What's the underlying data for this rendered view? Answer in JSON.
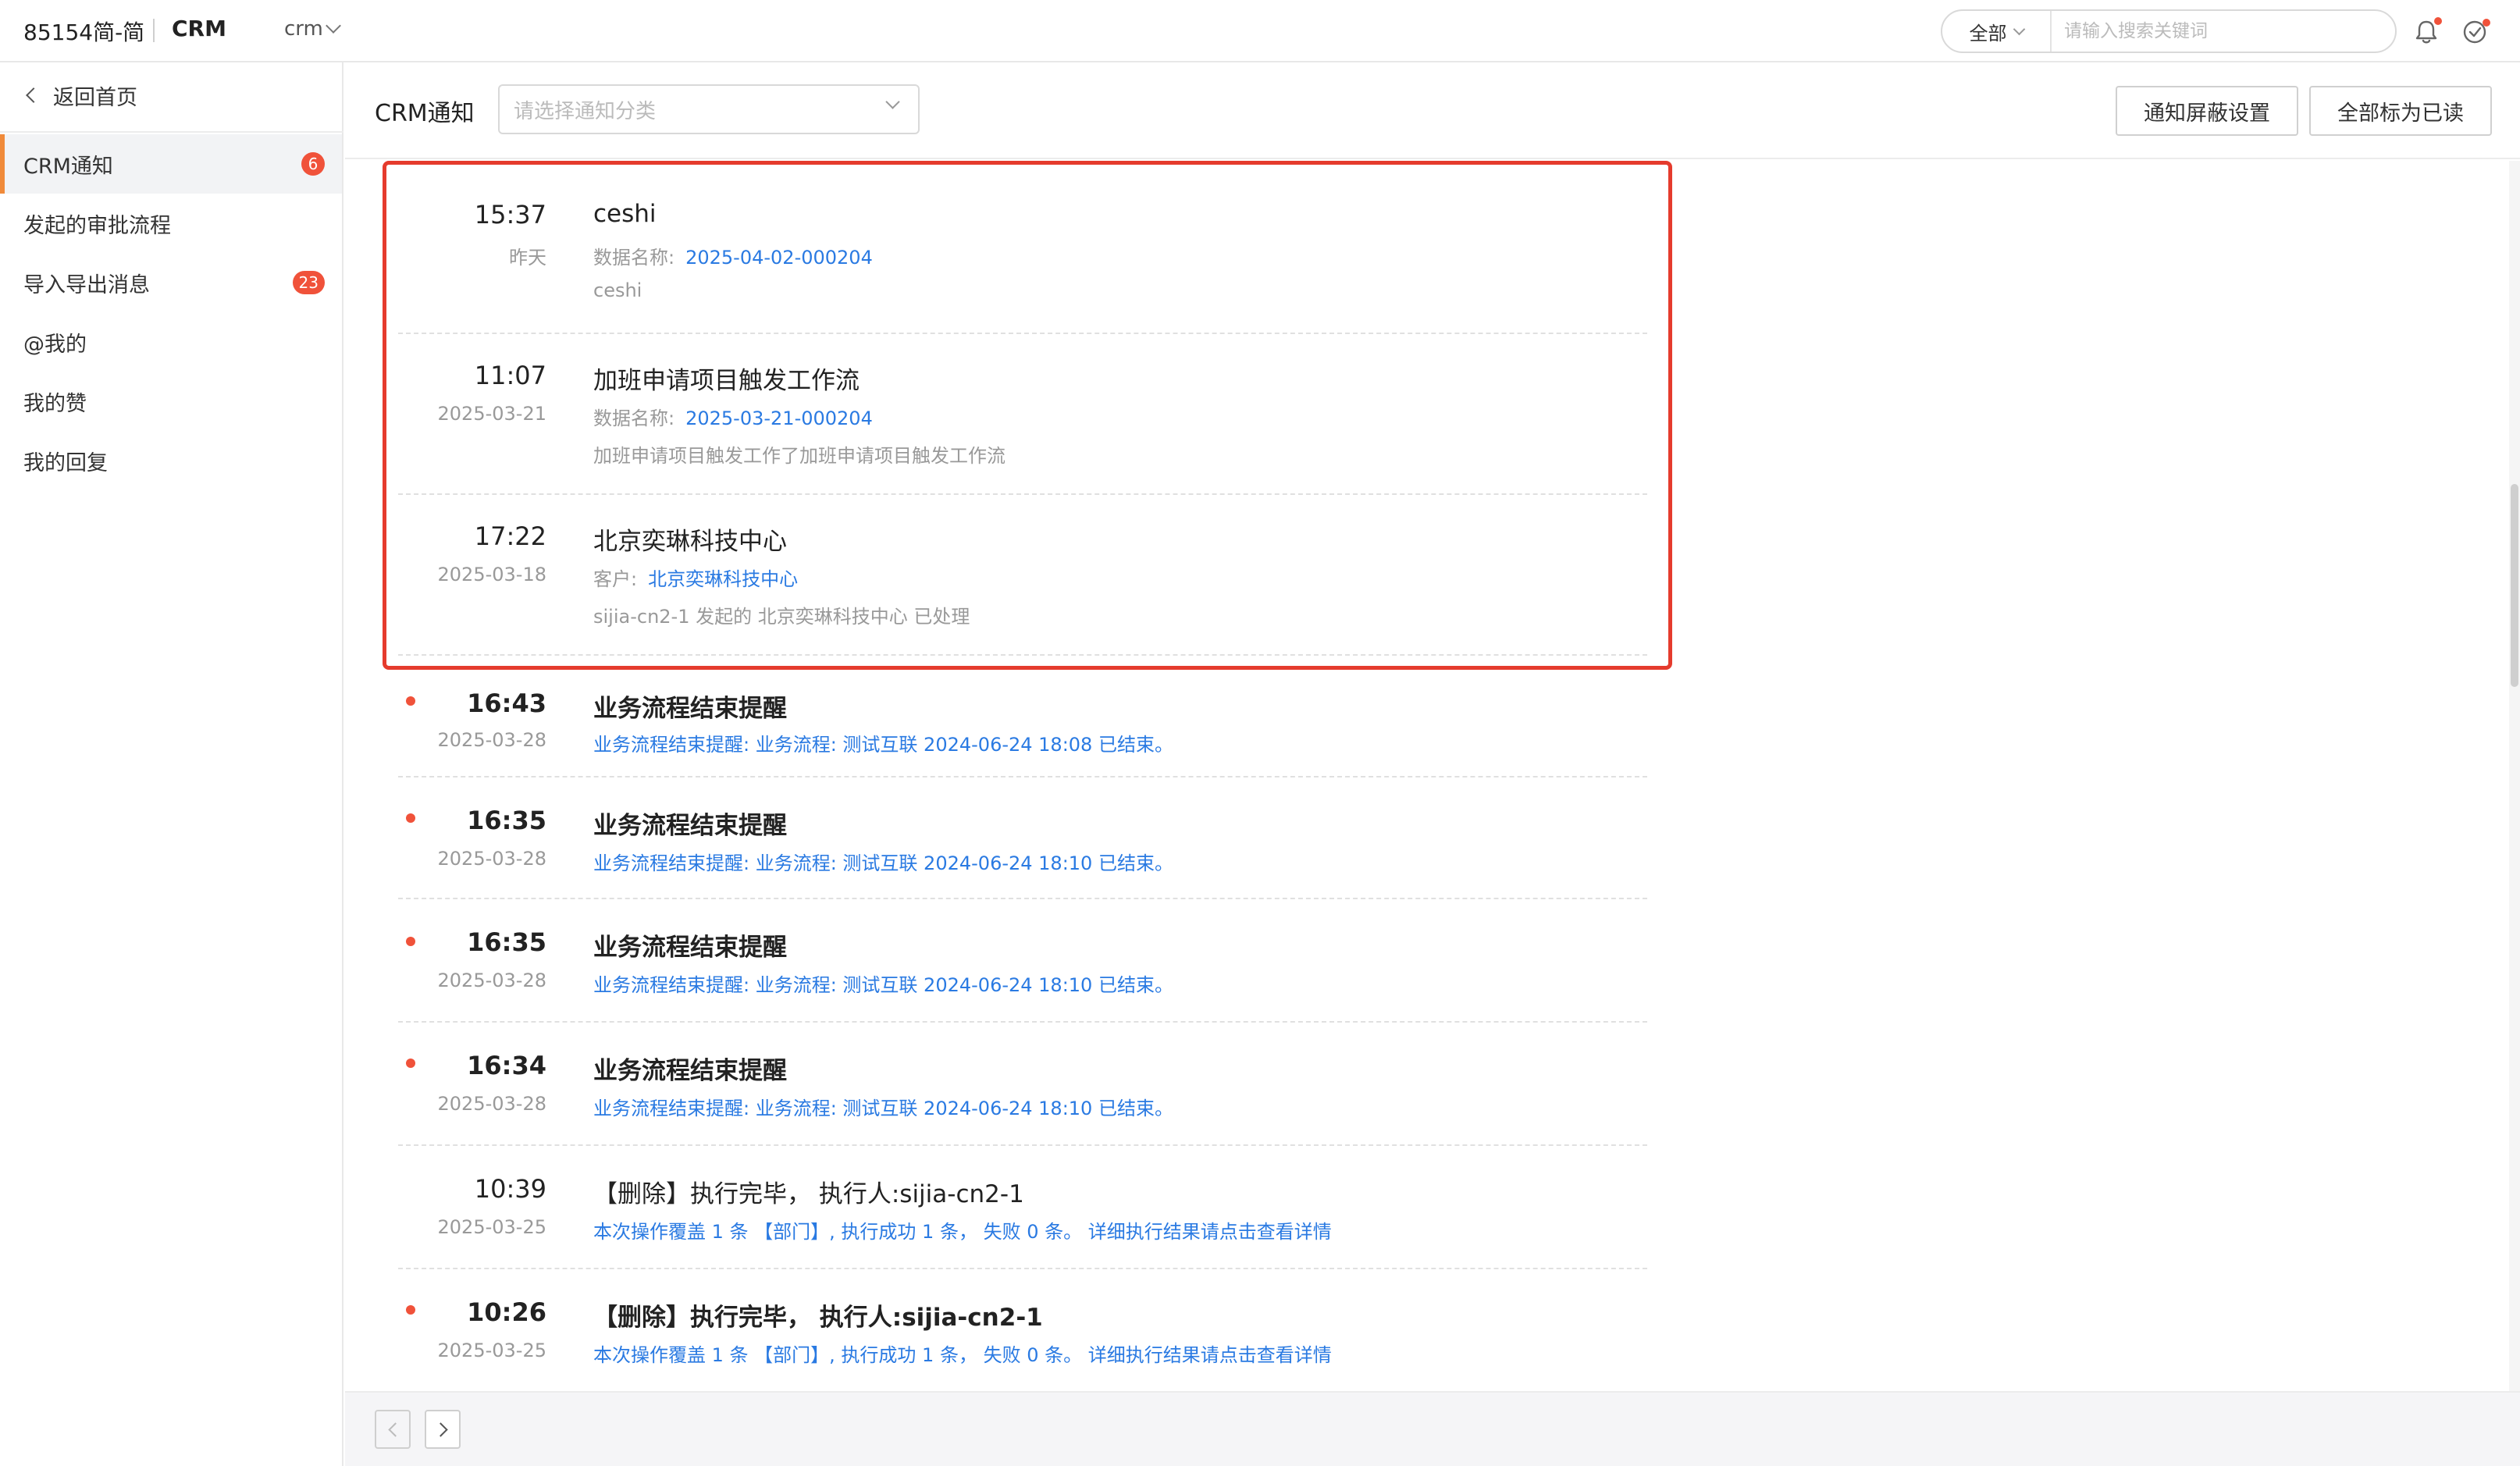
{
  "topbar": {
    "brand": "85154简-简",
    "app_name": "CRM",
    "switcher_label": "crm",
    "search_scope": "全部",
    "search_placeholder": "请输入搜索关键词"
  },
  "sidebar": {
    "back_label": "返回首页",
    "items": [
      {
        "label": "CRM通知",
        "badge": "6",
        "active": true
      },
      {
        "label": "发起的审批流程",
        "badge": ""
      },
      {
        "label": "导入导出消息",
        "badge": "23"
      },
      {
        "label": "@我的",
        "badge": ""
      },
      {
        "label": "我的赞",
        "badge": ""
      },
      {
        "label": "我的回复",
        "badge": ""
      }
    ]
  },
  "main": {
    "title": "CRM通知",
    "category_placeholder": "请选择通知分类",
    "mute_settings_label": "通知屏蔽设置",
    "mark_all_read_label": "全部标为已读"
  },
  "notifications": [
    {
      "time": "15:37",
      "date": "昨天",
      "title": "ceshi",
      "field_label": "数据名称:",
      "field_value": "2025-04-02-000204",
      "desc": "ceshi",
      "unread": false
    },
    {
      "time": "11:07",
      "date": "2025-03-21",
      "title": "加班申请项目触发工作流",
      "field_label": "数据名称:",
      "field_value": "2025-03-21-000204",
      "desc": "加班申请项目触发工作了加班申请项目触发工作流",
      "unread": false
    },
    {
      "time": "17:22",
      "date": "2025-03-18",
      "title": "北京奕琳科技中心",
      "field_label": "客户:",
      "field_value": "北京奕琳科技中心",
      "desc": "sijia-cn2-1 发起的 北京奕琳科技中心 已处理",
      "unread": false
    },
    {
      "time": "16:43",
      "date": "2025-03-28",
      "title": "业务流程结束提醒",
      "link": "业务流程结束提醒:  业务流程: 测试互联 2024-06-24 18:08 已结束。",
      "unread": true
    },
    {
      "time": "16:35",
      "date": "2025-03-28",
      "title": "业务流程结束提醒",
      "link": "业务流程结束提醒:  业务流程: 测试互联 2024-06-24 18:10 已结束。",
      "unread": true
    },
    {
      "time": "16:35",
      "date": "2025-03-28",
      "title": "业务流程结束提醒",
      "link": "业务流程结束提醒:  业务流程: 测试互联 2024-06-24 18:10 已结束。",
      "unread": true
    },
    {
      "time": "16:34",
      "date": "2025-03-28",
      "title": "业务流程结束提醒",
      "link": "业务流程结束提醒:  业务流程: 测试互联 2024-06-24 18:10 已结束。",
      "unread": true
    },
    {
      "time": "10:39",
      "date": "2025-03-25",
      "title": "【删除】执行完毕， 执行人:sijia-cn2-1",
      "link": "本次操作覆盖 1 条 【部门】, 执行成功 1 条， 失败 0 条。 详细执行结果请点击查看详情",
      "unread": false
    },
    {
      "time": "10:26",
      "date": "2025-03-25",
      "title": "【删除】执行完毕， 执行人:sijia-cn2-1",
      "link": "本次操作覆盖 1 条 【部门】, 执行成功 1 条， 失败 0 条。 详细执行结果请点击查看详情",
      "unread": true
    }
  ],
  "colors": {
    "accent_blue": "#2a7ae2",
    "badge_red": "#f0523a",
    "highlight_red": "#e53b2d",
    "active_bar": "#f08a3a"
  }
}
